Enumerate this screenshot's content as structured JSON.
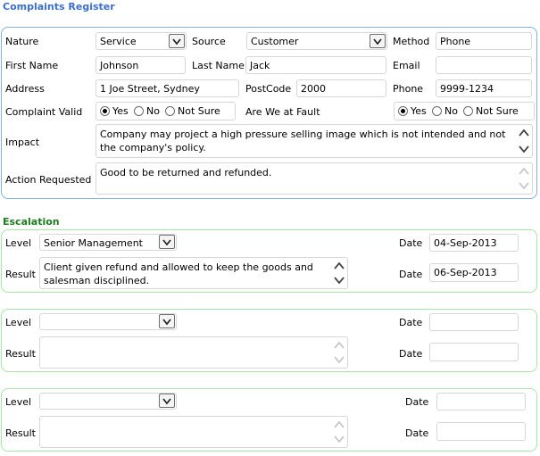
{
  "complaints": {
    "title": "Complaints Register",
    "nature_label": "Nature",
    "nature_value": "Service",
    "source_label": "Source",
    "source_value": "Customer",
    "method_label": "Method",
    "method_value": "Phone",
    "first_name_label": "First Name",
    "first_name_value": "Johnson",
    "last_name_label": "Last Name",
    "last_name_value": "Jack",
    "email_label": "Email",
    "email_value": "",
    "address_label": "Address",
    "address_value": "1 Joe Street, Sydney",
    "postcode_label": "PostCode",
    "postcode_value": "2000",
    "phone_label": "Phone",
    "phone_value": "9999-1234",
    "valid_label": "Complaint Valid",
    "fault_label": "Are We at Fault",
    "radio_yes": "Yes",
    "radio_no": "No",
    "radio_not_sure": "Not Sure",
    "valid_selected": "Yes",
    "fault_selected": "Yes",
    "impact_label": "Impact",
    "impact_value": "Company may project a high pressure selling image which is not intended and not the company's policy.",
    "action_label": "Action Requested",
    "action_value": "Good to be returned and refunded."
  },
  "escalation": {
    "title": "Escalation",
    "level_label": "Level",
    "result_label": "Result",
    "date_label": "Date",
    "rows": [
      {
        "level": "Senior Management",
        "date1": "04-Sep-2013",
        "result": "Client given refund and allowed to keep the goods and salesman disciplined.",
        "date2": "06-Sep-2013"
      },
      {
        "level": "",
        "date1": "",
        "result": "",
        "date2": ""
      },
      {
        "level": "",
        "date1": "",
        "result": "",
        "date2": ""
      }
    ]
  },
  "colors": {
    "complaints_title": "#3a6fd0",
    "escalation_title": "#1f7a1f",
    "panel_blue": "#7fb2e6",
    "panel_green": "#a6e6a6"
  }
}
